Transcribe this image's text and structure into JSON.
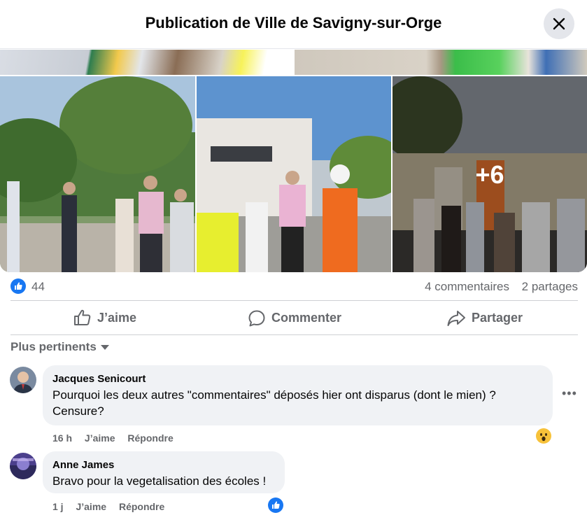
{
  "header": {
    "title": "Publication de Ville de Savigny-sur-Orge"
  },
  "photos": {
    "more_label": "+6"
  },
  "stats": {
    "likes": "44",
    "comments": "4 commentaires",
    "shares": "2 partages"
  },
  "actions": {
    "like": "J’aime",
    "comment": "Commenter",
    "share": "Partager"
  },
  "sort": {
    "label": "Plus pertinents"
  },
  "comments": [
    {
      "author": "Jacques Senicourt",
      "text_line1": "Pourquoi les deux autres \"commentaires\" déposés hier ont disparus (dont le mien) ?",
      "text_line2": "Censure?",
      "time": "16 h",
      "like": "J’aime",
      "reply": "Répondre",
      "reaction_icon": "wow-emoji-icon"
    },
    {
      "author": "Anne James",
      "text": "Bravo pour la vegetalisation des écoles !",
      "time": "1 j",
      "like": "J’aime",
      "reply": "Répondre",
      "reaction_icon": "like-reaction-icon"
    }
  ],
  "colors": {
    "accent": "#1877f2",
    "secondary_text": "#65676b",
    "bubble": "#f0f2f5"
  }
}
